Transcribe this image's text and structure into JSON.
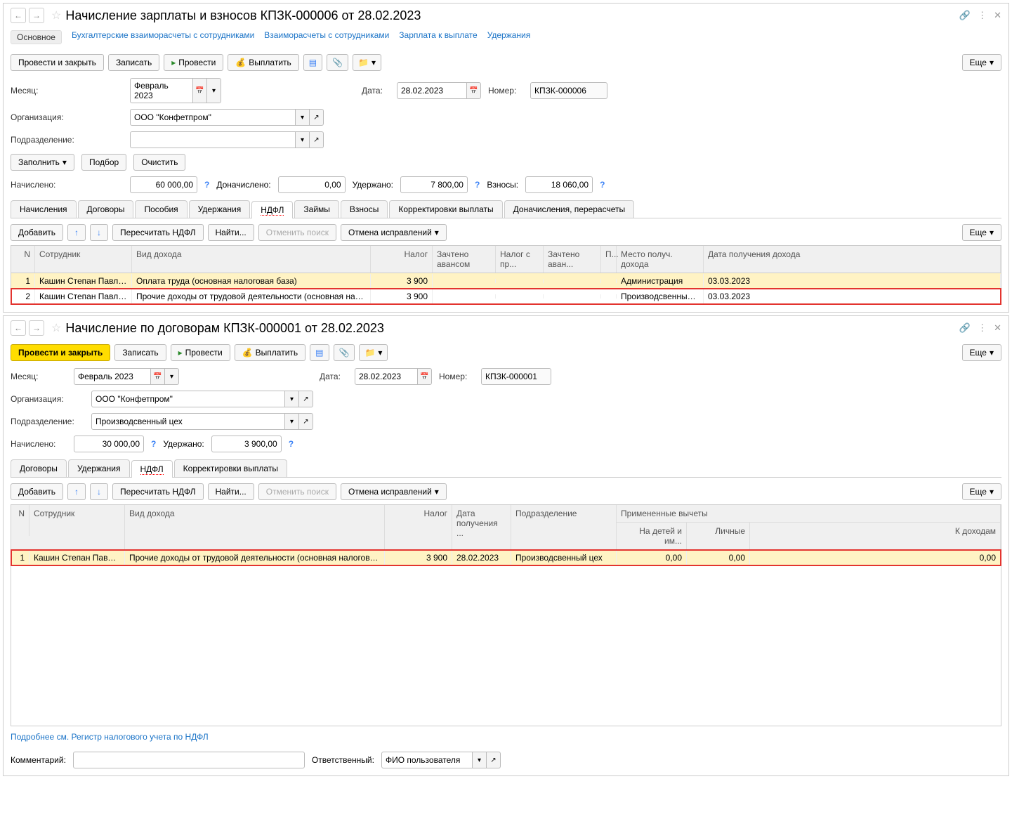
{
  "win1": {
    "title": "Начисление зарплаты и взносов КПЗК-000006 от 28.02.2023",
    "navtabs": [
      "Основное",
      "Бухгалтерские взаиморасчеты с сотрудниками",
      "Взаиморасчеты с сотрудниками",
      "Зарплата к выплате",
      "Удержания"
    ],
    "toolbar": {
      "post_close": "Провести и закрыть",
      "save": "Записать",
      "post": "Провести",
      "pay": "Выплатить",
      "more": "Еще"
    },
    "form": {
      "month_lbl": "Месяц:",
      "month": "Февраль 2023",
      "date_lbl": "Дата:",
      "date": "28.02.2023",
      "number_lbl": "Номер:",
      "number": "КПЗК-000006",
      "org_lbl": "Организация:",
      "org": "ООО \"Конфетпром\"",
      "dept_lbl": "Подразделение:",
      "dept": "",
      "fill_btn": "Заполнить",
      "select_btn": "Подбор",
      "clear_btn": "Очистить",
      "accrued_lbl": "Начислено:",
      "accrued": "60 000,00",
      "doaccrued_lbl": "Доначислено:",
      "doaccrued": "0,00",
      "withheld_lbl": "Удержано:",
      "withheld": "7 800,00",
      "contrib_lbl": "Взносы:",
      "contrib": "18 060,00"
    },
    "inner_tabs": [
      "Начисления",
      "Договоры",
      "Пособия",
      "Удержания",
      "НДФЛ",
      "Займы",
      "Взносы",
      "Корректировки выплаты",
      "Доначисления, перерасчеты"
    ],
    "inner_active": 4,
    "sub": {
      "add": "Добавить",
      "recalc": "Пересчитать НДФЛ",
      "find": "Найти...",
      "cancel_find": "Отменить поиск",
      "cancel_fix": "Отмена исправлений",
      "more": "Еще"
    },
    "grid": {
      "head": [
        "N",
        "Сотрудник",
        "Вид дохода",
        "Налог",
        "Зачтено авансом",
        "Налог с пр...",
        "Зачтено аван...",
        "П...",
        "Место получ. дохода",
        "Дата получения дохода"
      ],
      "rows": [
        {
          "n": "1",
          "emp": "Кашин Степан Павлович",
          "kind": "Оплата труда (основная налоговая база)",
          "tax": "3 900",
          "place": "Администрация",
          "date": "03.03.2023",
          "sel": true,
          "red": false
        },
        {
          "n": "2",
          "emp": "Кашин Степан Павлович",
          "kind": "Прочие доходы от трудовой деятельности (основная налоговая база)",
          "tax": "3 900",
          "place": "Производсвенный цех",
          "date": "03.03.2023",
          "sel": false,
          "red": true
        }
      ]
    }
  },
  "win2": {
    "title": "Начисление по договорам КПЗК-000001 от 28.02.2023",
    "toolbar": {
      "post_close": "Провести и закрыть",
      "save": "Записать",
      "post": "Провести",
      "pay": "Выплатить",
      "more": "Еще"
    },
    "form": {
      "month_lbl": "Месяц:",
      "month": "Февраль 2023",
      "date_lbl": "Дата:",
      "date": "28.02.2023",
      "number_lbl": "Номер:",
      "number": "КПЗК-000001",
      "org_lbl": "Организация:",
      "org": "ООО \"Конфетпром\"",
      "dept_lbl": "Подразделение:",
      "dept": "Производсвенный цех",
      "accrued_lbl": "Начислено:",
      "accrued": "30 000,00",
      "withheld_lbl": "Удержано:",
      "withheld": "3 900,00"
    },
    "inner_tabs": [
      "Договоры",
      "Удержания",
      "НДФЛ",
      "Корректировки выплаты"
    ],
    "inner_active": 2,
    "sub": {
      "add": "Добавить",
      "recalc": "Пересчитать НДФЛ",
      "find": "Найти...",
      "cancel_find": "Отменить поиск",
      "cancel_fix": "Отмена исправлений",
      "more": "Еще"
    },
    "grid": {
      "head": [
        "N",
        "Сотрудник",
        "Вид дохода",
        "Налог",
        "Дата получения ...",
        "Подразделение",
        "Примененные вычеты"
      ],
      "sub": [
        "На детей и им...",
        "Личные",
        "К доходам"
      ],
      "rows": [
        {
          "n": "1",
          "emp": "Кашин Степан Павлович",
          "kind": "Прочие доходы от трудовой деятельности (основная налоговая база)",
          "tax": "3 900",
          "date": "28.02.2023",
          "dept": "Производсвенный цех",
          "d1": "0,00",
          "d2": "0,00",
          "d3": "0,00"
        }
      ]
    },
    "link": "Подробнее см. Регистр налогового учета по НДФЛ",
    "comment_lbl": "Комментарий:",
    "comment": "",
    "resp_lbl": "Ответственный:",
    "resp": "ФИО пользователя"
  }
}
